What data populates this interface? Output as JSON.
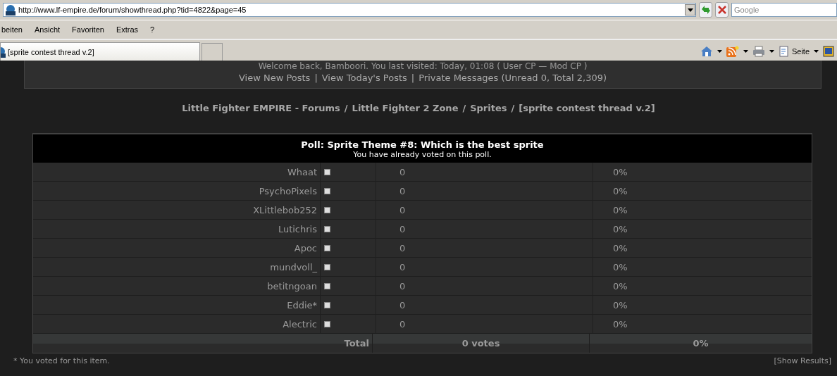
{
  "browser": {
    "url": "http://www.lf-empire.de/forum/showthread.php?tid=4822&page=45",
    "search_placeholder": "Google",
    "menu": [
      "beiten",
      "Ansicht",
      "Favoriten",
      "Extras",
      "?"
    ],
    "tab": "[sprite contest thread v.2]",
    "toolbar_label": "Seite"
  },
  "header": {
    "welcome": "Welcome back, Bamboori. You last visited: Today, 01:08 ( User CP — Mod CP )",
    "link_separator": "|",
    "links": [
      "View New Posts",
      "View Today's Posts",
      "Private Messages (Unread 0, Total 2,309)"
    ]
  },
  "breadcrumb_separator": "/",
  "breadcrumb": [
    "Little Fighter EMPIRE - Forums",
    "Little Fighter 2 Zone",
    "Sprites",
    "[sprite contest thread v.2]"
  ],
  "poll": {
    "title": "Poll: Sprite Theme #8: Which is the best sprite",
    "subtitle": "You have already voted on this poll.",
    "options": [
      {
        "name": "Whaat",
        "votes": "0",
        "percent": "0%"
      },
      {
        "name": "PsychoPixels",
        "votes": "0",
        "percent": "0%"
      },
      {
        "name": "XLittlebob252",
        "votes": "0",
        "percent": "0%"
      },
      {
        "name": "Lutichris",
        "votes": "0",
        "percent": "0%"
      },
      {
        "name": "Apoc",
        "votes": "0",
        "percent": "0%"
      },
      {
        "name": "mundvoll_",
        "votes": "0",
        "percent": "0%"
      },
      {
        "name": "betitngoan",
        "votes": "0",
        "percent": "0%"
      },
      {
        "name": "Eddie*",
        "votes": "0",
        "percent": "0%"
      },
      {
        "name": "Alectric",
        "votes": "0",
        "percent": "0%"
      }
    ],
    "total_label": "Total",
    "total_votes": "0 votes",
    "total_percent": "0%"
  },
  "footnote": "* You voted for this item.",
  "show_results": "[Show Results]"
}
